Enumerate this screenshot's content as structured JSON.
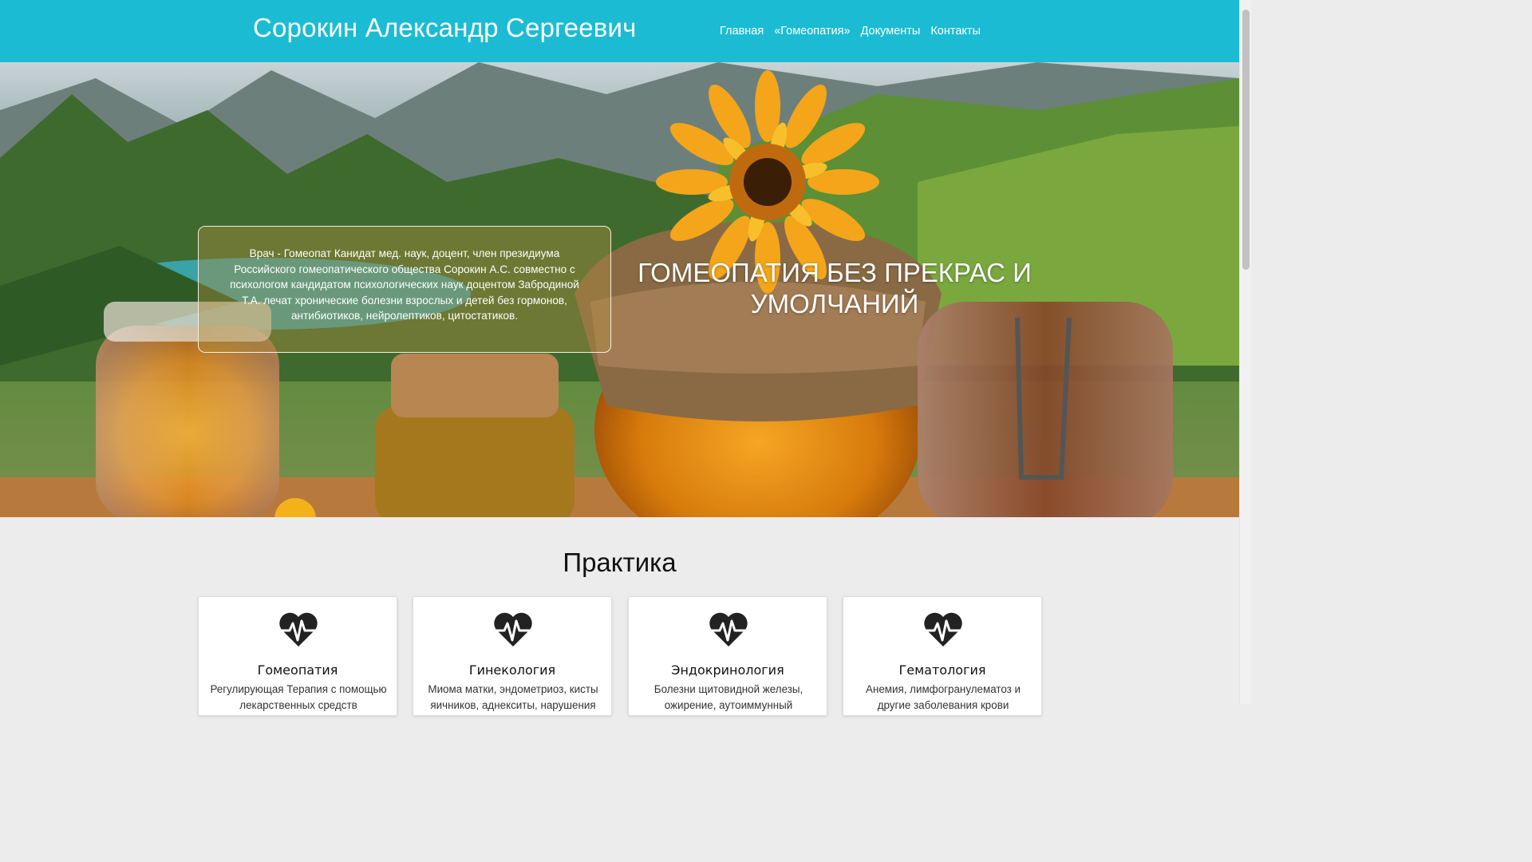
{
  "header": {
    "site_title": "Сорокин Александр Сергеевич",
    "nav": [
      "Главная",
      "«Гомеопатия»",
      "Документы",
      "Контакты"
    ]
  },
  "hero": {
    "info_text": "Врач - Гомеопат Канидат мед. наук, доцент, член президиума Российского гомеопатического общества Сорокин А.С. совместно с психологом кандидатом психологических наук доцентом Забродиной Т.А. лечат хронические болезни взрослых и детей без гормонов, антибиотиков, нейролептиков, цитостатиков.",
    "headline": "ГОМЕОПАТИЯ БЕЗ ПРЕКРАС И УМОЛЧАНИЙ"
  },
  "practice": {
    "title": "Практика",
    "cards": [
      {
        "title": "Гомеопатия",
        "text": "Регулирующая Терапия с помощью лекарственных средств"
      },
      {
        "title": "Гинекология",
        "text": "Миома матки, эндометриоз, кисты яичников, аднекситы, нарушения"
      },
      {
        "title": "Эндокринология",
        "text": "Болезни щитовидной железы, ожирение, аутоиммунный"
      },
      {
        "title": "Гематология",
        "text": "Анемия, лимфогранулематоз и другие заболевания крови"
      }
    ]
  },
  "colors": {
    "header_bg": "#1bbcd3",
    "page_bg": "#ececec",
    "icon": "#222222"
  },
  "icons": {
    "card_icon": "heart-pulse-icon"
  }
}
